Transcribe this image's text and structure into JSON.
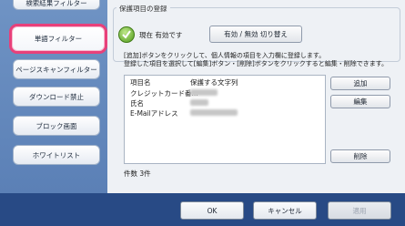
{
  "sidebar": {
    "items": [
      {
        "label": "検索結果フィルター"
      },
      {
        "label": "単語フィルター"
      },
      {
        "label": "ページスキャンフィルター"
      },
      {
        "label": "ダウンロード禁止"
      },
      {
        "label": "ブロック画面"
      },
      {
        "label": "ホワイトリスト"
      }
    ]
  },
  "group": {
    "title": "保護項目の登録",
    "status_text": "現在 有効です",
    "toggle_label": "有効 / 無効 切り替え",
    "description_line1": "[追加]ボタンをクリックして、個人情報の項目を入力欄に登録します。",
    "description_line2": "登録した項目を選択して[編集]ボタン・[削除]ボタンをクリックすると編集・削除できます。"
  },
  "list": {
    "headers": [
      "項目名",
      "保護する文字列"
    ],
    "rows": [
      {
        "name": "クレジットカード番..."
      },
      {
        "name": "氏名"
      },
      {
        "name": "E-Mailアドレス"
      }
    ],
    "count_text": "件数 3件"
  },
  "actions": {
    "add_label": "追加",
    "edit_label": "編集",
    "delete_label": "削除"
  },
  "footer": {
    "ok_label": "OK",
    "cancel_label": "キャンセル",
    "apply_label": "適用"
  }
}
